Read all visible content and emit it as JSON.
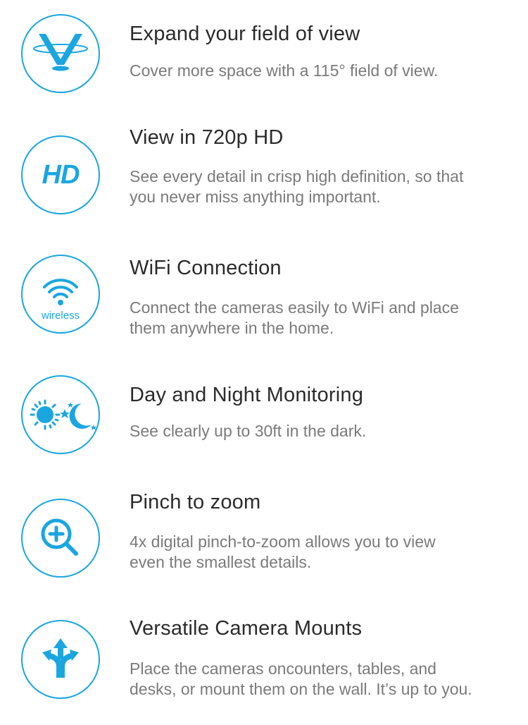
{
  "colors": {
    "accent": "#1aa6e0",
    "title": "#2b2b2b",
    "description": "#7a7a7a"
  },
  "features": [
    {
      "icon": "field-of-view-icon",
      "title": "Expand your field of view",
      "lines": [
        "Cover more space with a 115° field of view."
      ]
    },
    {
      "icon": "hd-icon",
      "icon_text": "HD",
      "title": "View in 720p HD",
      "lines": [
        "See every detail in crisp high definition, so that",
        "you never miss anything important."
      ]
    },
    {
      "icon": "wifi-icon",
      "icon_text": "wireless",
      "title": "WiFi Connection",
      "lines": [
        "Connect the cameras easily to WiFi and place",
        "them anywhere in the home."
      ]
    },
    {
      "icon": "day-night-icon",
      "title": "Day and Night Monitoring",
      "lines": [
        "See clearly up to 30ft in the dark."
      ]
    },
    {
      "icon": "zoom-in-icon",
      "title": "Pinch to zoom",
      "lines": [
        "4x digital pinch-to-zoom allows you to view",
        "even the smallest details."
      ]
    },
    {
      "icon": "mount-arrows-icon",
      "title": "Versatile Camera Mounts",
      "lines": [
        "Place the cameras oncounters, tables, and",
        "desks, or mount them on the wall. It’s up to you."
      ]
    }
  ]
}
